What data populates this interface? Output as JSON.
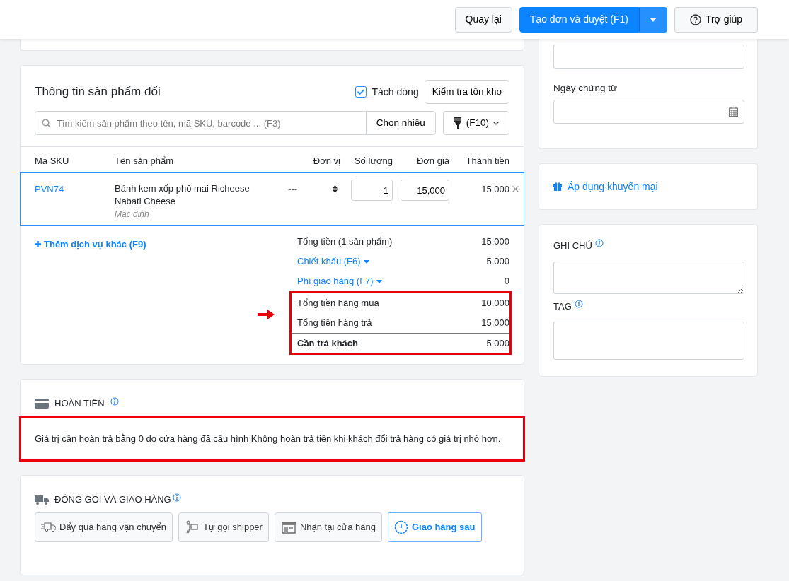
{
  "header": {
    "buttons": [
      {
        "label": "Quay lại",
        "kind": "plain"
      },
      {
        "label": "Tạo đơn và duyệt (F1)",
        "kind": "primary"
      },
      {
        "label": "Trợ giúp",
        "kind": "help"
      }
    ]
  },
  "product_card": {
    "title": "Thông tin sản phẩm đổi",
    "split_lines": {
      "label": "Tách dòng",
      "checked": true
    },
    "stock_button": "Kiểm tra tồn kho",
    "search": {
      "placeholder": "Tìm kiếm sản phẩm theo tên, mã SKU, barcode ... (F3)"
    },
    "multi_button": "Chọn nhiều",
    "filter_button": "(F10)",
    "table": {
      "columns": [
        "Mã SKU",
        "Tên sản phẩm",
        "Đơn vị",
        "Số lượng",
        "Đơn giá",
        "Thành tiền"
      ],
      "rows": [
        {
          "sku": "PVN74",
          "name": "Bánh kem xốp phô mai Richeese Nabati Cheese",
          "variant": "Mặc định",
          "unit": "---",
          "quantity": "1",
          "price": "15,000",
          "total": "15,000",
          "selected": true
        }
      ]
    },
    "add_service": "Thêm dịch vụ khác (F9)",
    "summary": [
      {
        "label": "Tổng tiền (1 sản phẩm)",
        "value": "15,000",
        "kind": "plain",
        "highlighted": false
      },
      {
        "label": "Chiết khấu (F6)",
        "value": "5,000",
        "kind": "link",
        "highlighted": false
      },
      {
        "label": "Phí giao hàng (F7)",
        "value": "0",
        "kind": "link",
        "highlighted": false
      },
      {
        "label": "Tổng tiền hàng mua",
        "value": "10,000",
        "kind": "plain",
        "highlighted": true
      },
      {
        "label": "Tổng tiền hàng trả",
        "value": "15,000",
        "kind": "plain",
        "highlighted": true
      },
      {
        "label": "Cần trả khách",
        "value": "5,000",
        "kind": "total",
        "highlighted": true
      }
    ]
  },
  "refund_card": {
    "title": "HOÀN TIỀN",
    "message": "Giá trị cần hoàn trả bằng 0 do cửa hàng đã cấu hình Không hoàn trả tiền khi khách đổi trả hàng có giá trị nhỏ hơn.",
    "highlighted": true
  },
  "shipping_card": {
    "title": "ĐÓNG GÓI VÀ GIAO HÀNG",
    "options": [
      {
        "label": "Đẩy qua hãng vận chuyển",
        "kind": "truck",
        "selected": false
      },
      {
        "label": "Tự gọi shipper",
        "kind": "courier",
        "selected": false
      },
      {
        "label": "Nhận tại cửa hàng",
        "kind": "store",
        "selected": false
      },
      {
        "label": "Giao hàng sau",
        "kind": "clock",
        "selected": true
      }
    ]
  },
  "info_card": {
    "date_label": "Ngày chứng từ"
  },
  "promo": {
    "label": "Áp dụng khuyến mại"
  },
  "notes_card": {
    "note_label": "GHI CHÚ",
    "tag_label": "TAG"
  }
}
